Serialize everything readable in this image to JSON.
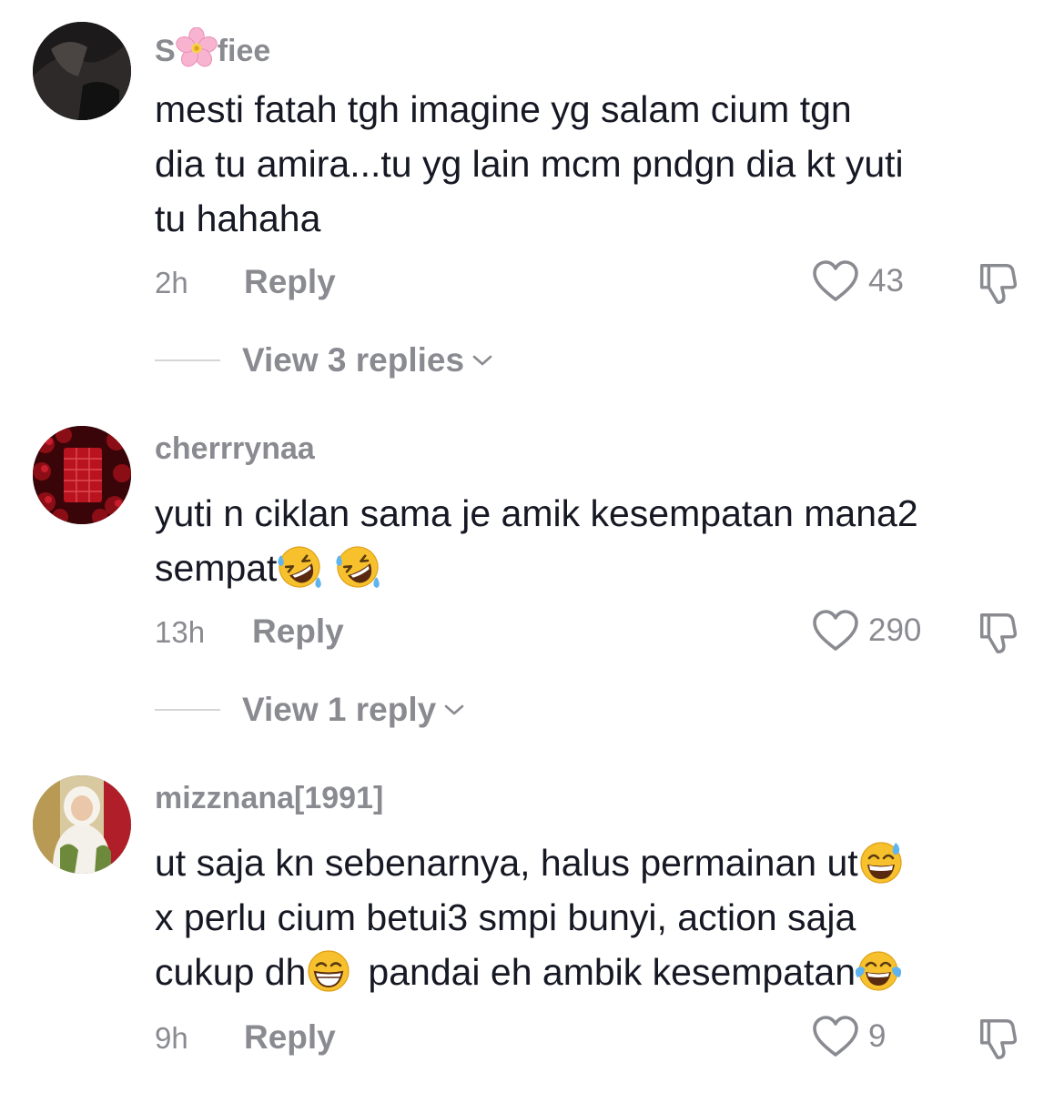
{
  "comments": [
    {
      "username_prefix": "S",
      "username_suffix": "fiee",
      "username_emoji": "cherry-blossom-icon",
      "lines": [
        "mesti fatah tgh imagine yg salam cium tgn",
        "dia tu amira...tu yg lain mcm pndgn dia kt yuti",
        "tu hahaha"
      ],
      "time": "2h",
      "reply_label": "Reply",
      "likes": "43",
      "view_replies": "View 3 replies"
    },
    {
      "username": "cherrrynaa",
      "line1": "yuti n ciklan sama je amik kesempatan mana2",
      "line2": "sempat",
      "line2_emojis": [
        "rolling-on-floor-laughing-icon",
        "rolling-on-floor-laughing-icon"
      ],
      "time": "13h",
      "reply_label": "Reply",
      "likes": "290",
      "view_replies": "View 1 reply"
    },
    {
      "username": "mizznana[1991]",
      "line1": "ut saja kn sebenarnya, halus permainan ut",
      "line1_emoji": "grinning-sweat-icon",
      "line2": "x perlu cium betui3 smpi bunyi, action saja",
      "line3a": "cukup dh",
      "line3a_emoji": "grinning-squinting-icon",
      "line3b": "pandai eh ambik kesempatan",
      "line3b_emoji": "tears-of-joy-icon",
      "time": "9h",
      "reply_label": "Reply",
      "likes": "9"
    }
  ]
}
